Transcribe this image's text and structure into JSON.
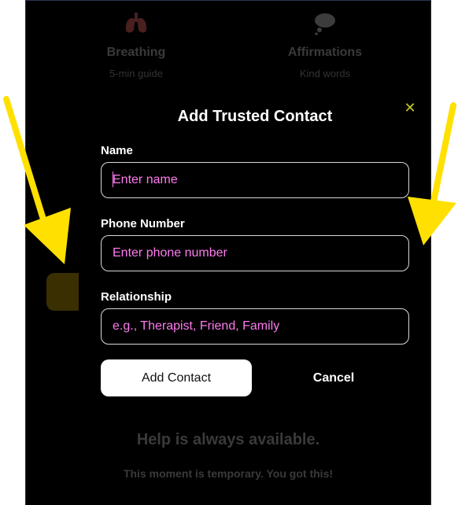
{
  "background_tiles": [
    {
      "title": "Breathing",
      "subtitle": "5-min guide",
      "icon": "lungs-icon"
    },
    {
      "title": "Affirmations",
      "subtitle": "Kind words",
      "icon": "thought-bubble-icon"
    }
  ],
  "modal": {
    "title": "Add Trusted Contact",
    "close_icon": "close-icon",
    "fields": {
      "name": {
        "label": "Name",
        "placeholder": "Enter name",
        "value": ""
      },
      "phone": {
        "label": "Phone Number",
        "placeholder": "Enter phone number",
        "value": ""
      },
      "relationship": {
        "label": "Relationship",
        "placeholder": "e.g., Therapist, Friend, Family",
        "value": ""
      }
    },
    "buttons": {
      "add": "Add Contact",
      "cancel": "Cancel"
    }
  },
  "footer": {
    "message": "Help is always available.",
    "encouragement": "This moment is temporary. You got this!"
  },
  "colors": {
    "placeholder": "#ff7bf0",
    "accent_yellow": "#ffe000",
    "close": "#c8c81e",
    "background": "#000000"
  }
}
